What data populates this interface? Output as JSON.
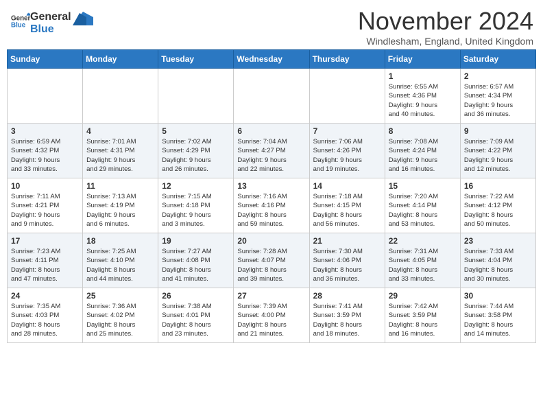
{
  "logo": {
    "line1": "General",
    "line2": "Blue"
  },
  "title": "November 2024",
  "location": "Windlesham, England, United Kingdom",
  "days_of_week": [
    "Sunday",
    "Monday",
    "Tuesday",
    "Wednesday",
    "Thursday",
    "Friday",
    "Saturday"
  ],
  "weeks": [
    [
      {
        "day": "",
        "info": ""
      },
      {
        "day": "",
        "info": ""
      },
      {
        "day": "",
        "info": ""
      },
      {
        "day": "",
        "info": ""
      },
      {
        "day": "",
        "info": ""
      },
      {
        "day": "1",
        "info": "Sunrise: 6:55 AM\nSunset: 4:36 PM\nDaylight: 9 hours\nand 40 minutes."
      },
      {
        "day": "2",
        "info": "Sunrise: 6:57 AM\nSunset: 4:34 PM\nDaylight: 9 hours\nand 36 minutes."
      }
    ],
    [
      {
        "day": "3",
        "info": "Sunrise: 6:59 AM\nSunset: 4:32 PM\nDaylight: 9 hours\nand 33 minutes."
      },
      {
        "day": "4",
        "info": "Sunrise: 7:01 AM\nSunset: 4:31 PM\nDaylight: 9 hours\nand 29 minutes."
      },
      {
        "day": "5",
        "info": "Sunrise: 7:02 AM\nSunset: 4:29 PM\nDaylight: 9 hours\nand 26 minutes."
      },
      {
        "day": "6",
        "info": "Sunrise: 7:04 AM\nSunset: 4:27 PM\nDaylight: 9 hours\nand 22 minutes."
      },
      {
        "day": "7",
        "info": "Sunrise: 7:06 AM\nSunset: 4:26 PM\nDaylight: 9 hours\nand 19 minutes."
      },
      {
        "day": "8",
        "info": "Sunrise: 7:08 AM\nSunset: 4:24 PM\nDaylight: 9 hours\nand 16 minutes."
      },
      {
        "day": "9",
        "info": "Sunrise: 7:09 AM\nSunset: 4:22 PM\nDaylight: 9 hours\nand 12 minutes."
      }
    ],
    [
      {
        "day": "10",
        "info": "Sunrise: 7:11 AM\nSunset: 4:21 PM\nDaylight: 9 hours\nand 9 minutes."
      },
      {
        "day": "11",
        "info": "Sunrise: 7:13 AM\nSunset: 4:19 PM\nDaylight: 9 hours\nand 6 minutes."
      },
      {
        "day": "12",
        "info": "Sunrise: 7:15 AM\nSunset: 4:18 PM\nDaylight: 9 hours\nand 3 minutes."
      },
      {
        "day": "13",
        "info": "Sunrise: 7:16 AM\nSunset: 4:16 PM\nDaylight: 8 hours\nand 59 minutes."
      },
      {
        "day": "14",
        "info": "Sunrise: 7:18 AM\nSunset: 4:15 PM\nDaylight: 8 hours\nand 56 minutes."
      },
      {
        "day": "15",
        "info": "Sunrise: 7:20 AM\nSunset: 4:14 PM\nDaylight: 8 hours\nand 53 minutes."
      },
      {
        "day": "16",
        "info": "Sunrise: 7:22 AM\nSunset: 4:12 PM\nDaylight: 8 hours\nand 50 minutes."
      }
    ],
    [
      {
        "day": "17",
        "info": "Sunrise: 7:23 AM\nSunset: 4:11 PM\nDaylight: 8 hours\nand 47 minutes."
      },
      {
        "day": "18",
        "info": "Sunrise: 7:25 AM\nSunset: 4:10 PM\nDaylight: 8 hours\nand 44 minutes."
      },
      {
        "day": "19",
        "info": "Sunrise: 7:27 AM\nSunset: 4:08 PM\nDaylight: 8 hours\nand 41 minutes."
      },
      {
        "day": "20",
        "info": "Sunrise: 7:28 AM\nSunset: 4:07 PM\nDaylight: 8 hours\nand 39 minutes."
      },
      {
        "day": "21",
        "info": "Sunrise: 7:30 AM\nSunset: 4:06 PM\nDaylight: 8 hours\nand 36 minutes."
      },
      {
        "day": "22",
        "info": "Sunrise: 7:31 AM\nSunset: 4:05 PM\nDaylight: 8 hours\nand 33 minutes."
      },
      {
        "day": "23",
        "info": "Sunrise: 7:33 AM\nSunset: 4:04 PM\nDaylight: 8 hours\nand 30 minutes."
      }
    ],
    [
      {
        "day": "24",
        "info": "Sunrise: 7:35 AM\nSunset: 4:03 PM\nDaylight: 8 hours\nand 28 minutes."
      },
      {
        "day": "25",
        "info": "Sunrise: 7:36 AM\nSunset: 4:02 PM\nDaylight: 8 hours\nand 25 minutes."
      },
      {
        "day": "26",
        "info": "Sunrise: 7:38 AM\nSunset: 4:01 PM\nDaylight: 8 hours\nand 23 minutes."
      },
      {
        "day": "27",
        "info": "Sunrise: 7:39 AM\nSunset: 4:00 PM\nDaylight: 8 hours\nand 21 minutes."
      },
      {
        "day": "28",
        "info": "Sunrise: 7:41 AM\nSunset: 3:59 PM\nDaylight: 8 hours\nand 18 minutes."
      },
      {
        "day": "29",
        "info": "Sunrise: 7:42 AM\nSunset: 3:59 PM\nDaylight: 8 hours\nand 16 minutes."
      },
      {
        "day": "30",
        "info": "Sunrise: 7:44 AM\nSunset: 3:58 PM\nDaylight: 8 hours\nand 14 minutes."
      }
    ]
  ]
}
